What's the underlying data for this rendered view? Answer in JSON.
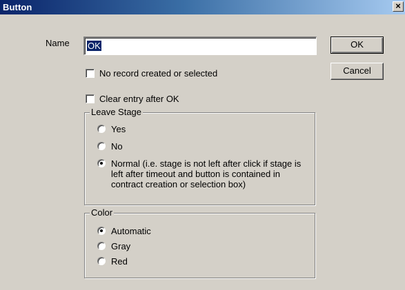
{
  "window": {
    "title": "Button",
    "close_glyph": "×"
  },
  "form": {
    "name_label": "Name",
    "name_value": "OK",
    "no_record_label": "No record created or selected",
    "no_record_checked": false,
    "clear_entry_label": "Clear entry after OK",
    "clear_entry_checked": false
  },
  "buttons": {
    "ok_label": "OK",
    "cancel_label": "Cancel"
  },
  "leave_stage": {
    "title": "Leave Stage",
    "options": [
      {
        "label": "Yes",
        "checked": false
      },
      {
        "label": "No",
        "checked": false
      },
      {
        "label": "Normal (i.e. stage is not left after click if stage is left after timeout and button is contained in contract creation or selection box)",
        "checked": true
      }
    ]
  },
  "color": {
    "title": "Color",
    "options": [
      {
        "label": "Automatic",
        "checked": true
      },
      {
        "label": "Gray",
        "checked": false
      },
      {
        "label": "Red",
        "checked": false
      }
    ]
  },
  "colors": {
    "dialog_bg": "#d4d0c8",
    "title_start": "#0a246a",
    "title_end": "#a6caf0",
    "selection": "#0a246a"
  }
}
